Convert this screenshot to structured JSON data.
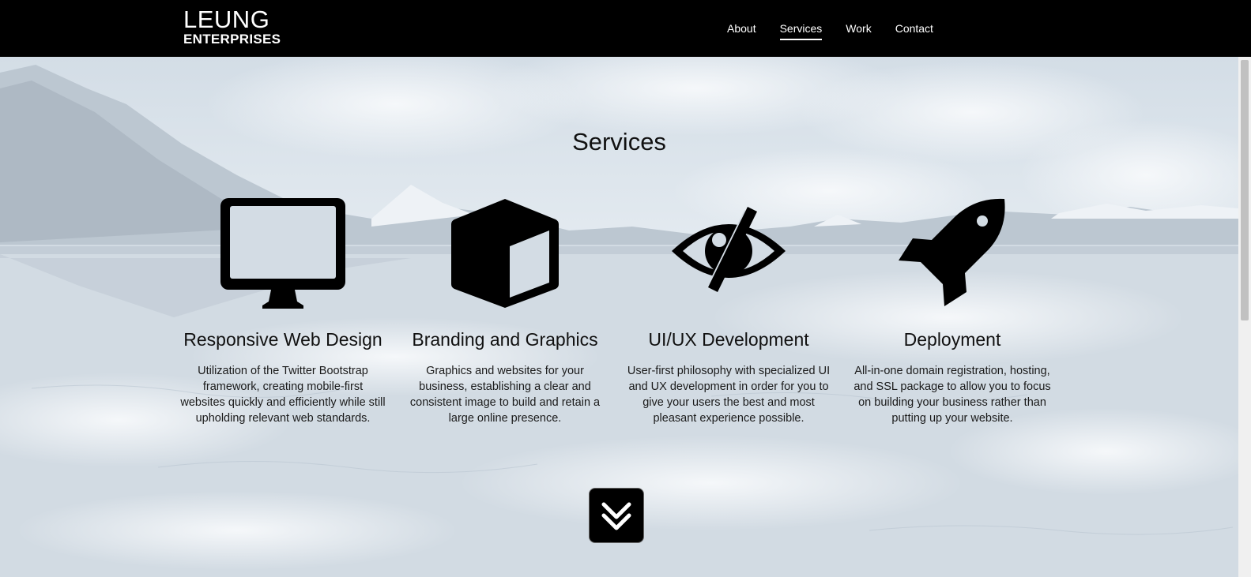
{
  "brand": {
    "line1": "LEUNG",
    "line2": "ENTERPRISES"
  },
  "nav": [
    {
      "label": "About",
      "active": false
    },
    {
      "label": "Services",
      "active": true
    },
    {
      "label": "Work",
      "active": false
    },
    {
      "label": "Contact",
      "active": false
    }
  ],
  "section": {
    "title": "Services"
  },
  "services": [
    {
      "icon": "desktop-monitor-icon",
      "title": "Responsive Web Design",
      "text": "Utilization of the Twitter Bootstrap framework, creating mobile-first websites quickly and efficiently while still upholding relevant web standards."
    },
    {
      "icon": "cube-icon",
      "title": "Branding and Graphics",
      "text": "Graphics and websites for your business, establishing a clear and consistent image to build and retain a large online presence."
    },
    {
      "icon": "eye-slash-icon",
      "title": "UI/UX Development",
      "text": "User-first philosophy with specialized UI and UX development in order for you to give your users the best and most pleasant experience possible."
    },
    {
      "icon": "rocket-icon",
      "title": "Deployment",
      "text": "All-in-one domain registration, hosting, and SSL package to allow you to focus on building your business rather than putting up your website."
    }
  ],
  "scroll_button": {
    "icon": "double-chevron-down-icon"
  },
  "colors": {
    "navbar": "#000000",
    "text": "#111111",
    "background": "#dbe3ea"
  }
}
